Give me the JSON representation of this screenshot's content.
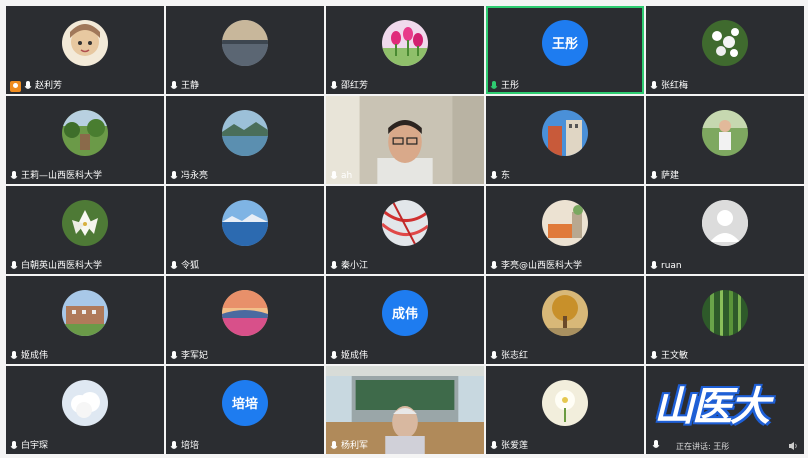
{
  "participants": [
    {
      "name": "赵利芳",
      "host": true,
      "avatar": "illustrated-face-avatar"
    },
    {
      "name": "王静",
      "avatar": "lake-sunset-photo-avatar"
    },
    {
      "name": "邵红芳",
      "avatar": "tulip-flowers-avatar"
    },
    {
      "name": "王彤",
      "avatar_text": "王彤",
      "active": true
    },
    {
      "name": "张红梅",
      "avatar": "white-blossom-avatar"
    },
    {
      "name": "王莉—山西医科大学",
      "avatar": "green-garden-avatar"
    },
    {
      "name": "冯永亮",
      "avatar": "lake-landscape-avatar"
    },
    {
      "name": "ah",
      "video": "man-with-glasses-video"
    },
    {
      "name": "东",
      "avatar": "building-sky-avatar"
    },
    {
      "name": "萨建",
      "avatar": "person-green-avatar"
    },
    {
      "name": "白朝英山西医科大学",
      "avatar": "lily-flower-avatar"
    },
    {
      "name": "令狐",
      "avatar": "blue-sea-avatar"
    },
    {
      "name": "秦小江",
      "avatar": "abstract-red-avatar"
    },
    {
      "name": "李亮@山西医科大学",
      "avatar": "cozy-room-avatar"
    },
    {
      "name": "ruan",
      "avatar": "default-user-avatar"
    },
    {
      "name": "姬成伟",
      "avatar": "campus-building-avatar"
    },
    {
      "name": "李军妃",
      "avatar": "pink-flower-field-avatar"
    },
    {
      "name": "姬成伟",
      "avatar_text": "成伟"
    },
    {
      "name": "张志红",
      "avatar": "autumn-tree-avatar"
    },
    {
      "name": "王文敏",
      "avatar": "bamboo-forest-avatar"
    },
    {
      "name": "白宇琛",
      "avatar": "cartoon-cloud-avatar"
    },
    {
      "name": "培培",
      "avatar_text": "培培"
    },
    {
      "name": "杨利军",
      "video": "man-in-classroom-video"
    },
    {
      "name": "张爱莲",
      "avatar": "white-flower-avatar"
    },
    {
      "logo": "山医大",
      "speaking_text": "正在讲话: 王彤"
    }
  ],
  "colors": {
    "tile_bg": "#2b2d31",
    "active_border": "#2ecc71",
    "text_avatar_bg": "#1e7cf0",
    "host_badge": "#f08c1e",
    "logo_blue": "#1e5fd6"
  }
}
